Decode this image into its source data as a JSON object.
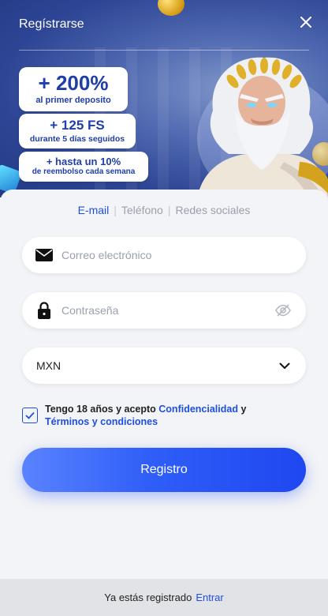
{
  "header": {
    "title": "Regístrarse",
    "close_icon": "close-icon"
  },
  "promos": [
    {
      "big": "+ 200%",
      "small": "al primer deposito"
    },
    {
      "big": "+ 125 FS",
      "small": "durante 5 días seguidos"
    },
    {
      "big": "+ hasta un 10%",
      "small": "de reembolso cada semana"
    }
  ],
  "tabs": [
    {
      "label": "E-mail",
      "active": true
    },
    {
      "label": "Teléfono",
      "active": false
    },
    {
      "label": "Redes sociales",
      "active": false
    }
  ],
  "form": {
    "email": {
      "placeholder": "Correo electrónico",
      "icon": "mail-icon"
    },
    "password": {
      "placeholder": "Contraseña",
      "icon": "lock-icon",
      "toggle_icon": "eye-off-icon"
    },
    "currency": {
      "value": "MXN",
      "icon": "chevron-down-icon"
    },
    "agree": {
      "checked": true,
      "text_prefix": "Tengo 18 años y acepto ",
      "link1": "Confidencialidad",
      "text_mid": " y",
      "link2": "Términos y condiciones"
    },
    "submit_label": "Registro"
  },
  "footer": {
    "question": "Ya estás registrado",
    "link": "Entrar"
  },
  "colors": {
    "accent": "#1f4fe0",
    "banner": "#2d4594",
    "promo_text": "#1f3ea8"
  }
}
